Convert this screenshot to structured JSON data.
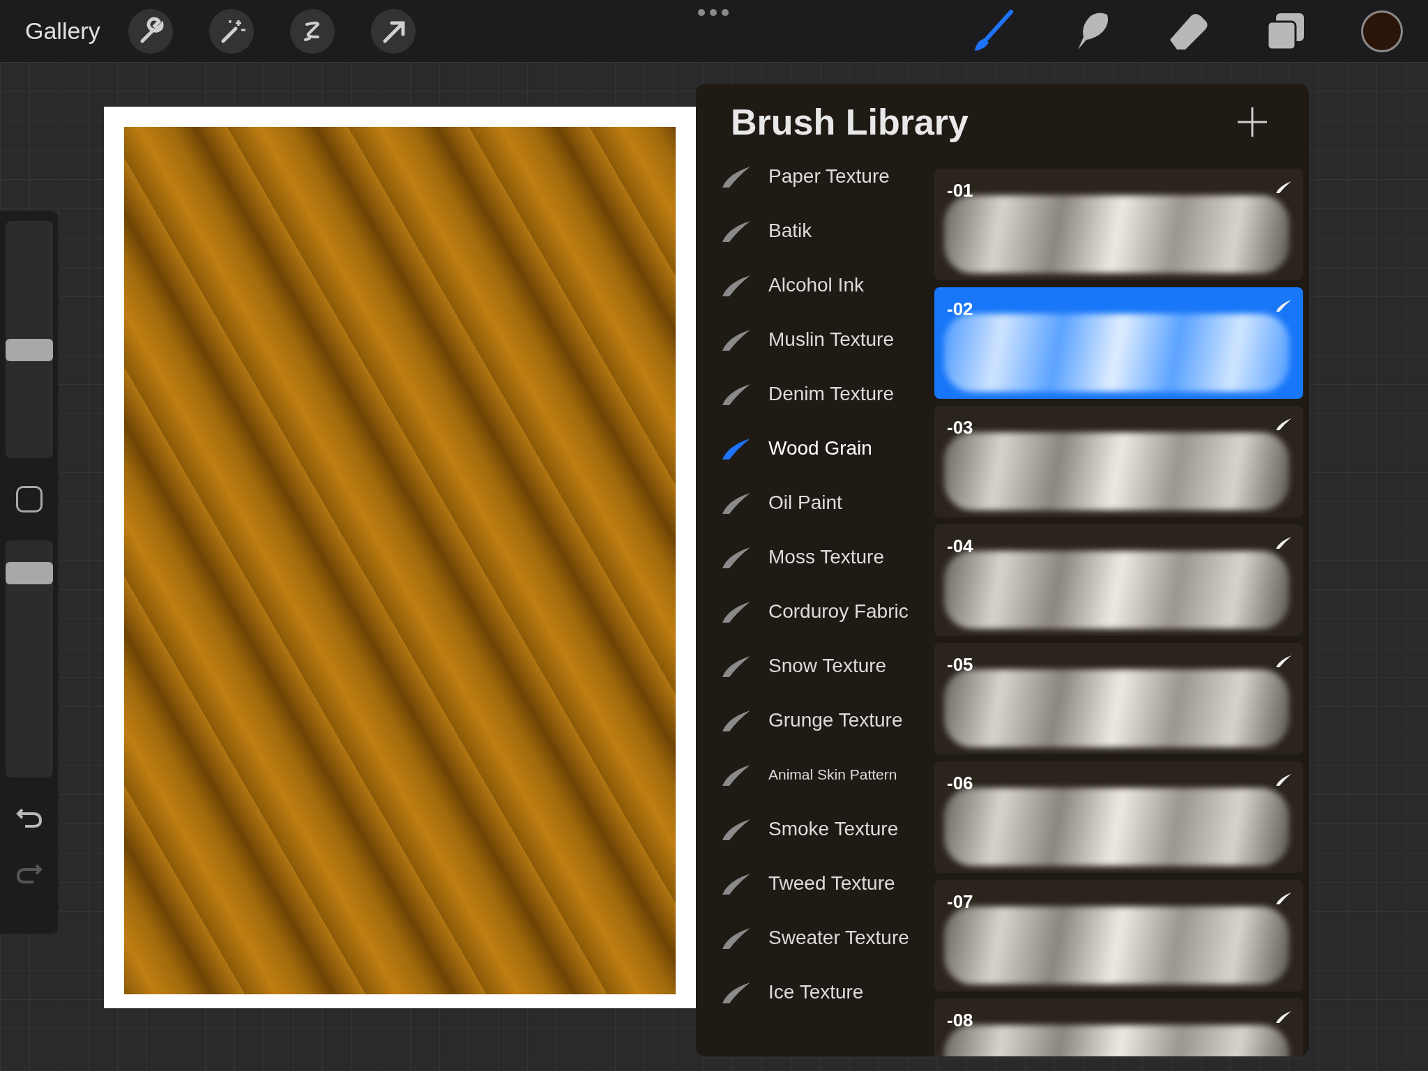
{
  "toolbar": {
    "gallery": "Gallery"
  },
  "sidebar": {
    "brush_size": {
      "level": 0.45
    },
    "opacity": {
      "level": 0.9
    }
  },
  "brush_library": {
    "title": "Brush Library",
    "sets": [
      {
        "label": "Paper Texture",
        "selected": false
      },
      {
        "label": "Batik",
        "selected": false
      },
      {
        "label": "Alcohol Ink",
        "selected": false
      },
      {
        "label": "Muslin Texture",
        "selected": false
      },
      {
        "label": "Denim Texture",
        "selected": false
      },
      {
        "label": "Wood Grain",
        "selected": true
      },
      {
        "label": "Oil Paint",
        "selected": false
      },
      {
        "label": "Moss Texture",
        "selected": false
      },
      {
        "label": "Corduroy Fabric",
        "selected": false
      },
      {
        "label": "Snow Texture",
        "selected": false
      },
      {
        "label": "Grunge Texture",
        "selected": false
      },
      {
        "label": "Animal Skin Pattern",
        "selected": false
      },
      {
        "label": "Smoke Texture",
        "selected": false
      },
      {
        "label": "Tweed Texture",
        "selected": false
      },
      {
        "label": "Sweater Texture",
        "selected": false
      },
      {
        "label": "Ice Texture",
        "selected": false
      }
    ],
    "brushes": [
      {
        "name": "-01",
        "selected": false
      },
      {
        "name": "-02",
        "selected": true
      },
      {
        "name": "-03",
        "selected": false
      },
      {
        "name": "-04",
        "selected": false
      },
      {
        "name": "-05",
        "selected": false
      },
      {
        "name": "-06",
        "selected": false
      },
      {
        "name": "-07",
        "selected": false
      },
      {
        "name": "-08",
        "selected": false
      }
    ]
  }
}
